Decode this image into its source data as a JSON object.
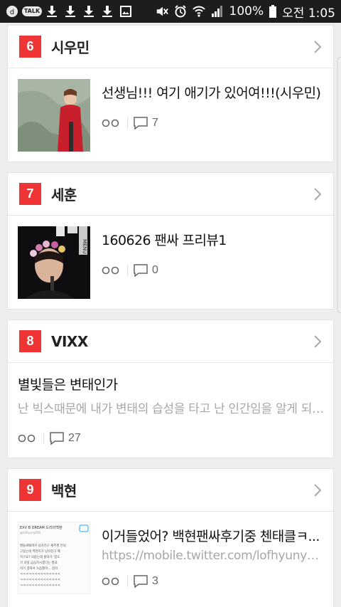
{
  "status_bar": {
    "battery": "100%",
    "time": "오전 1:05",
    "left_icons": [
      "kakao-icon",
      "talk-icon",
      "download-icon",
      "download-icon",
      "download-icon",
      "download-icon",
      "gallery-icon"
    ],
    "right_icons": [
      "mute-icon",
      "alarm-icon",
      "wifi-icon",
      "signal-icon",
      "battery-icon"
    ],
    "talk_label": "TALK"
  },
  "feed": [
    {
      "rank": "6",
      "category": "시우민",
      "title": "선생님!!! 여기 애기가 있어여!!!(시우민)",
      "subtitle": "",
      "comments": "7",
      "has_thumb": true
    },
    {
      "rank": "7",
      "category": "세훈",
      "title": "160626 팬싸 프리뷰1",
      "subtitle": "",
      "comments": "0",
      "has_thumb": true
    },
    {
      "rank": "8",
      "category": "VIXX",
      "title": "별빛들은 변태인가",
      "subtitle": "난 빅스때문에 내가 변태의 습성을 타고 난 인간임을 알게 되었어...",
      "comments": "27",
      "has_thumb": false
    },
    {
      "rank": "9",
      "category": "백현",
      "title": "이거들었어? 백현팬싸후기중 첸태클ㅋ...",
      "subtitle": "https://mobile.twitter.com/lofhyuny456/st...",
      "comments": "3",
      "has_thumb": true
    }
  ],
  "thumb_text": {
    "sehun_logo": "MENU",
    "baekhyun_header": "EXV B DREAM 드리미백현",
    "baekhyun_handle": "@lofhyuny456",
    "baekhyun_lines": [
      "팬들싸때까지 남자친구 제주편 안되",
      "고있는데 백현이가 남자친구 혜",
      "하구요? 되묻는데 홍대가 ‘꿈도",
      "가 과정 급습하시겠다는 발표",
      "이거 겹쳐서 녹음했어… 검자",
      "ㅋㅋㅋㅋㅋㅋㅋㅋㅋㅋㅋㅋㅋㅋ",
      "ㅋㅋㅋㅋㅋㅋㅋㅋㅋㅋㅋㅋㅋㅋ",
      "ㅋㅋㅋㅋㅋㅋㅋㅋㅋㅋㅋㅋㅋㅋ"
    ]
  }
}
